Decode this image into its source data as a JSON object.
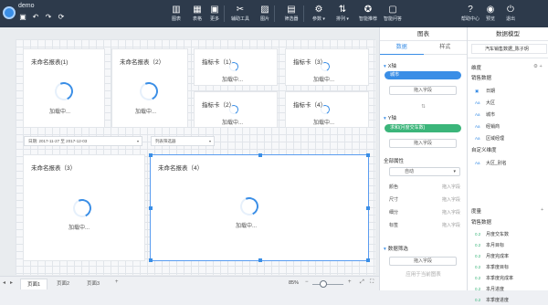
{
  "app": {
    "title": "demo"
  },
  "toolbar": [
    {
      "id": "chart",
      "icon": "bar-chart-icon",
      "glyph": "▥",
      "label": "图表"
    },
    {
      "id": "table",
      "icon": "table-icon",
      "glyph": "▦",
      "label": "表格"
    },
    {
      "id": "more",
      "icon": "grid-icon",
      "glyph": "▣",
      "label": "更多"
    },
    {
      "id": "tools",
      "icon": "wrench-icon",
      "glyph": "✂",
      "label": "辅助工具"
    },
    {
      "id": "image",
      "icon": "image-icon",
      "glyph": "▨",
      "label": "图片"
    },
    {
      "id": "filter",
      "icon": "filter-icon",
      "glyph": "▤",
      "label": "筛选器"
    },
    {
      "id": "param",
      "icon": "param-icon",
      "glyph": "⚙",
      "label": "参数 ▾"
    },
    {
      "id": "sort",
      "icon": "sort-icon",
      "glyph": "⇅",
      "label": "排列 ▾"
    },
    {
      "id": "smart",
      "icon": "smart-icon",
      "glyph": "✪",
      "label": "智能推荐"
    },
    {
      "id": "qa",
      "icon": "chat-icon",
      "glyph": "▢",
      "label": "智能问答"
    }
  ],
  "rightbar": [
    {
      "id": "help",
      "icon": "help-icon",
      "glyph": "?",
      "label": "帮助中心"
    },
    {
      "id": "preview",
      "icon": "eye-icon",
      "glyph": "◉",
      "label": "预览"
    },
    {
      "id": "exit",
      "icon": "exit-icon",
      "glyph": "⏻",
      "label": "退出"
    }
  ],
  "cards": {
    "report1": {
      "title": "未命名报表(1)",
      "loading": "加载中..."
    },
    "report2": {
      "title": "未命名报表（2）",
      "loading": "加载中..."
    },
    "kpi1": {
      "title": "指标卡（1）",
      "loading": "加载中..."
    },
    "kpi3": {
      "title": "指标卡（3）",
      "loading": "加载中..."
    },
    "kpi2": {
      "title": "指标卡（2）",
      "loading": "加载中..."
    },
    "kpi4": {
      "title": "指标卡（4）",
      "loading": "加载中..."
    },
    "report3": {
      "title": "未命名报表（3）",
      "loading": "加载中..."
    },
    "report4": {
      "title": "未命名报表（4）",
      "loading": "加载中..."
    }
  },
  "filters": {
    "date": "日期: 2017-11-27 至 2017-12-03",
    "list": "列表筛选器"
  },
  "pages": {
    "tabs": [
      "页面1",
      "页面2",
      "页面3"
    ],
    "add": "+",
    "zoom": "85%"
  },
  "chart_panel": {
    "title": "图表",
    "tabs": [
      "数据",
      "样式"
    ],
    "x_axis": {
      "label": "X轴",
      "field": "城市",
      "drop": "拖入字段"
    },
    "y_axis": {
      "label": "Y轴",
      "field": "求和(月度交车数)",
      "drop": "拖入字段"
    },
    "props": {
      "label": "全部属性",
      "select": "自动",
      "rows": [
        {
          "k": "颜色",
          "v": "拖入字段"
        },
        {
          "k": "尺寸",
          "v": "拖入字段"
        },
        {
          "k": "细分",
          "v": "拖入字段"
        },
        {
          "k": "标签",
          "v": "拖入字段"
        }
      ]
    },
    "data_filter": {
      "label": "数据筛选",
      "drop": "拖入字段",
      "apply": "应用于当前图表"
    }
  },
  "model_panel": {
    "title": "数据模型",
    "source": "汽车销售数据_陈子玥",
    "dims_label": "维度",
    "dims": [
      {
        "group": "销售数据",
        "items": [
          {
            "type": "date",
            "name": "日期"
          },
          {
            "type": "text",
            "name": "大区"
          },
          {
            "type": "text",
            "name": "城市"
          },
          {
            "type": "text",
            "name": "经销商"
          },
          {
            "type": "text",
            "name": "区域经理"
          }
        ]
      },
      {
        "group": "自定义维度",
        "items": [
          {
            "type": "text",
            "name": "大区_别名"
          }
        ]
      }
    ],
    "measures_label": "度量",
    "measures": [
      {
        "group": "销售数据",
        "items": [
          "月度交车数",
          "本月目标",
          "月度完成率",
          "本季度目标",
          "本季度完成率",
          "本月进度",
          "本季度进度"
        ]
      }
    ]
  }
}
